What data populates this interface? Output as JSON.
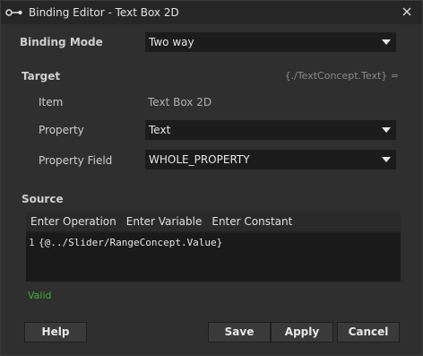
{
  "window": {
    "title": "Binding Editor - Text Box 2D"
  },
  "binding_mode": {
    "label": "Binding Mode",
    "value": "Two way"
  },
  "target": {
    "label": "Target",
    "path": "{./TextConcept.Text} =",
    "item_label": "Item",
    "item_value": "Text Box 2D",
    "property_label": "Property",
    "property_value": "Text",
    "property_field_label": "Property Field",
    "property_field_value": "WHOLE_PROPERTY"
  },
  "source": {
    "label": "Source",
    "toolbar": {
      "enter_operation": "Enter Operation",
      "enter_variable": "Enter Variable",
      "enter_constant": "Enter Constant"
    },
    "line_number": "1",
    "expression": "{@../Slider/RangeConcept.Value}"
  },
  "status": {
    "text": "Valid",
    "color": "#3cae3c"
  },
  "buttons": {
    "help": "Help",
    "save": "Save",
    "apply": "Apply",
    "cancel": "Cancel"
  }
}
